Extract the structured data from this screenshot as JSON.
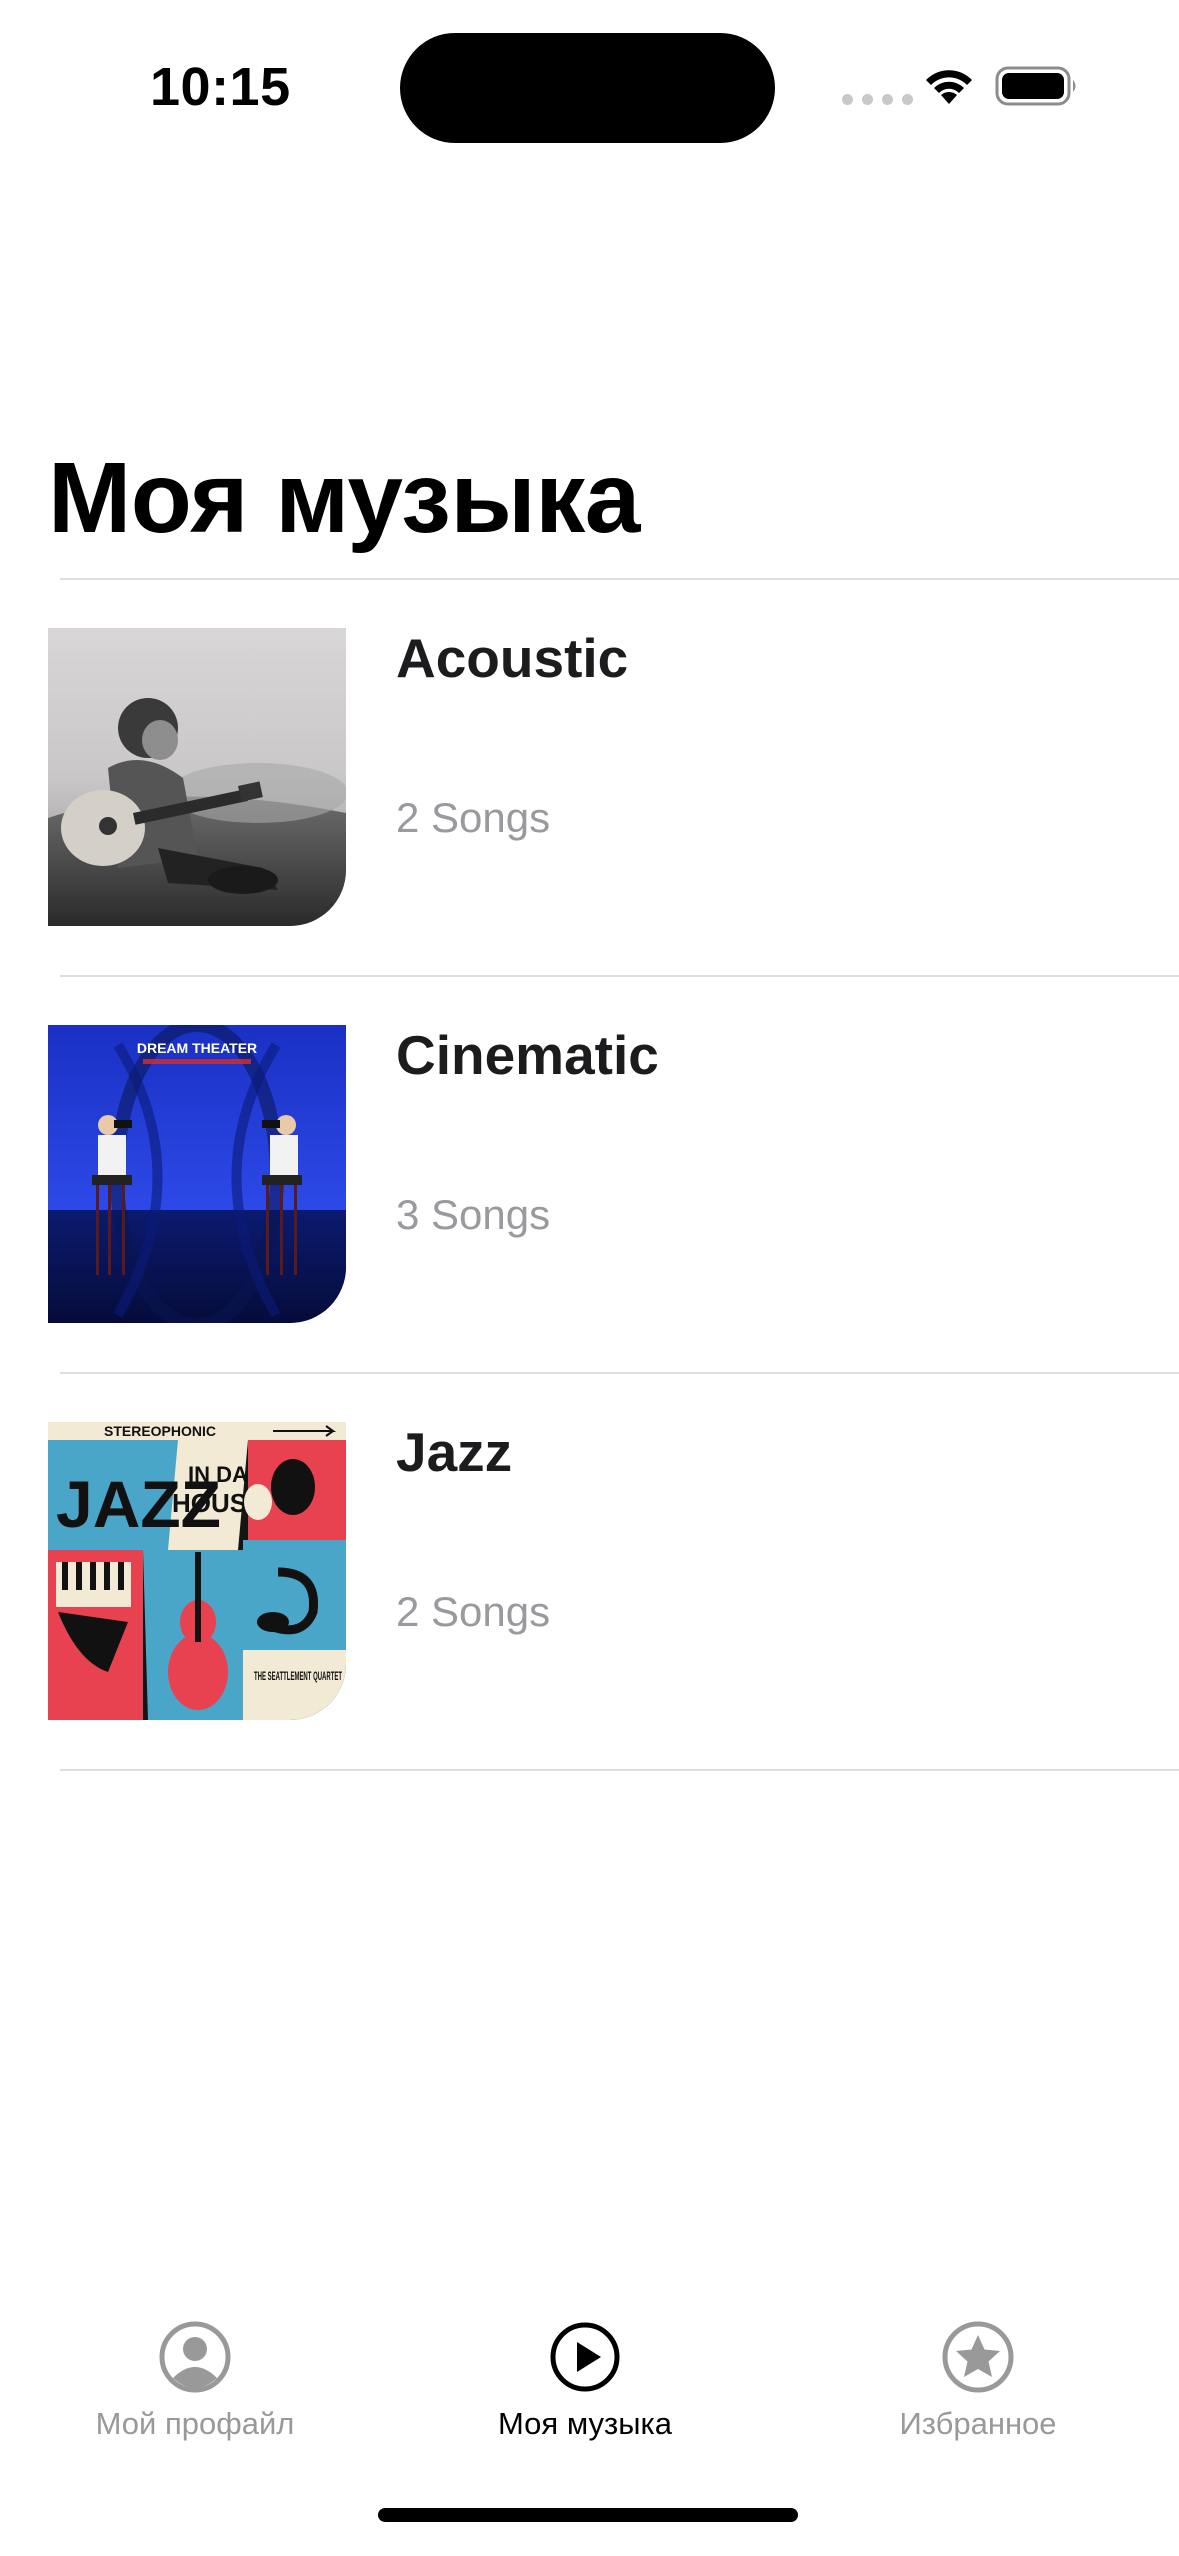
{
  "status_bar": {
    "time": "10:15",
    "wifi_icon": "wifi-icon",
    "battery_icon": "battery-icon"
  },
  "header": {
    "title": "Моя музыка"
  },
  "playlists": [
    {
      "title": "Acoustic",
      "subtitle": "2 Songs",
      "artwork": "acoustic-cover"
    },
    {
      "title": "Cinematic",
      "subtitle": "3 Songs",
      "artwork": "dream-theater-cover"
    },
    {
      "title": "Jazz",
      "subtitle": "2 Songs",
      "artwork": "jazz-in-da-house-cover"
    }
  ],
  "cover_art": {
    "cinematic_band": "DREAM THEATER",
    "jazz_banner": "STEREOPHONIC",
    "jazz_word": "JAZZ",
    "jazz_in_da": "IN DA",
    "jazz_house": "HOUSE",
    "jazz_band": "THE SEATTLEMENT QUARTET"
  },
  "tabbar": {
    "tabs": [
      {
        "label": "Мой профайл",
        "icon": "person-circle-icon",
        "active": false
      },
      {
        "label": "Моя музыка",
        "icon": "play-circle-icon",
        "active": true
      },
      {
        "label": "Избранное",
        "icon": "star-circle-icon",
        "active": false
      }
    ]
  },
  "colors": {
    "active_tab": "#000000",
    "inactive_tab": "#999999",
    "subtitle": "#9a9a9e",
    "divider": "#dedede"
  }
}
